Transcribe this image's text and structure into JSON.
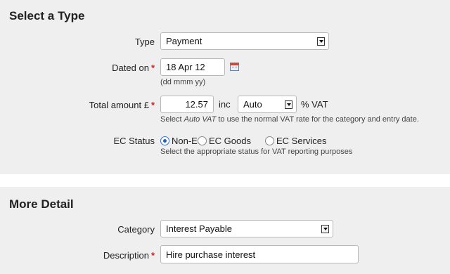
{
  "sections": {
    "type": {
      "heading": "Select a Type"
    },
    "detail": {
      "heading": "More Detail"
    }
  },
  "type_field": {
    "label": "Type",
    "value": "Payment"
  },
  "dated_on": {
    "label": "Dated on",
    "required": "*",
    "value": "18 Apr 12",
    "hint": "(dd mmm yy)",
    "icon": "calendar-icon"
  },
  "total_amount": {
    "label": "Total amount £",
    "required": "*",
    "value": "12.57",
    "inc_text": "inc",
    "vat_value": "Auto",
    "vat_suffix": "% VAT",
    "hint_before": "Select ",
    "hint_em": "Auto VAT",
    "hint_after": " to use the normal VAT rate for the category and entry date."
  },
  "ec_status": {
    "label": "EC Status",
    "options": [
      {
        "label": "Non-EC",
        "selected": true
      },
      {
        "label": "EC Goods",
        "selected": false
      },
      {
        "label": "EC Services",
        "selected": false
      }
    ],
    "hint": "Select the appropriate status for VAT reporting purposes"
  },
  "category": {
    "label": "Category",
    "value": "Interest Payable"
  },
  "description": {
    "label": "Description",
    "required": "*",
    "value": "Hire purchase interest"
  },
  "colors": {
    "panel": "#efefef",
    "required": "#d42020",
    "radio_selected": "#2a5fb8"
  }
}
